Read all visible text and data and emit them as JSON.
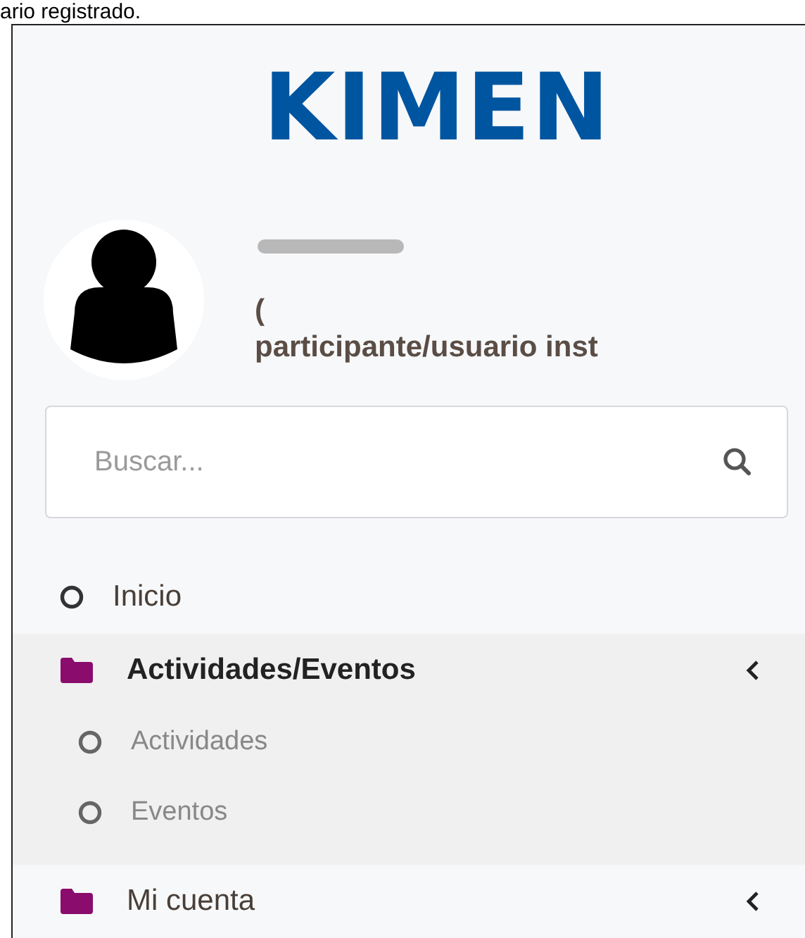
{
  "caption": "ario registrado.",
  "logo": "KIMEN",
  "user": {
    "role_open": "(",
    "role": "participante/usuario  inst"
  },
  "search": {
    "placeholder": "Buscar..."
  },
  "menu": [
    {
      "kind": "link",
      "label": "Inicio"
    },
    {
      "kind": "group",
      "label": "Actividades/Eventos",
      "expanded": true,
      "children": [
        {
          "label": "Actividades"
        },
        {
          "label": "Eventos"
        }
      ]
    },
    {
      "kind": "group",
      "label": "Mi cuenta",
      "expanded": false
    }
  ]
}
